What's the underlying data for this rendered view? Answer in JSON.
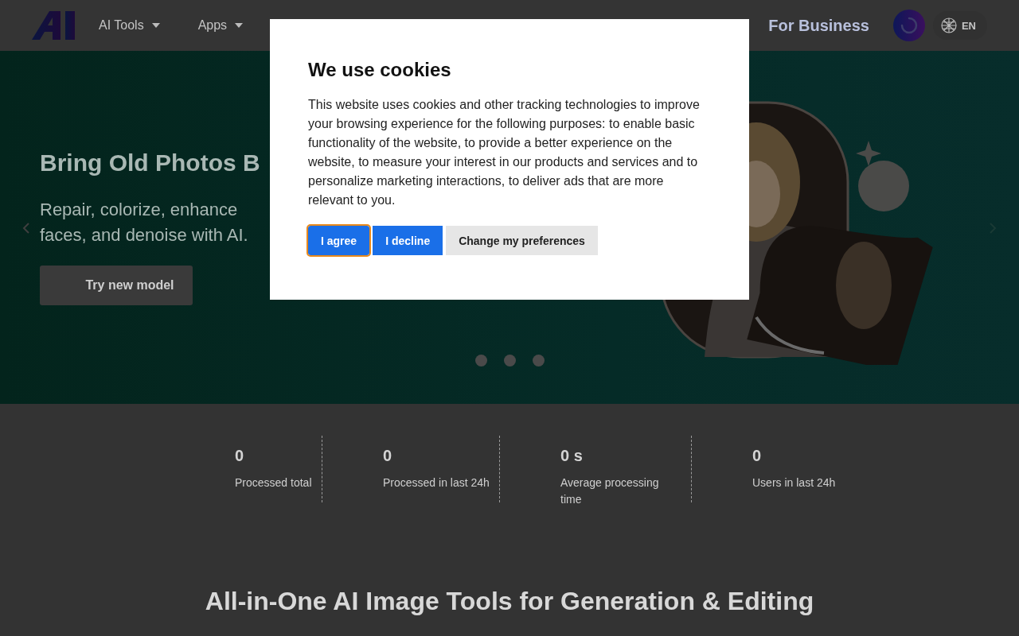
{
  "header": {
    "nav": [
      {
        "label": "AI Tools",
        "has_menu": true
      },
      {
        "label": "Apps",
        "has_menu": true
      }
    ],
    "business_link": "For Business",
    "language": "EN"
  },
  "hero": {
    "title": "Bring Old Photos B",
    "subtitle": "Repair, colorize, enhance faces, and denoise with AI.",
    "button": "Try new model",
    "carousel_dots": [
      {
        "selected": false
      },
      {
        "selected": false
      },
      {
        "selected": false
      }
    ]
  },
  "stats": [
    {
      "value": "0",
      "label": "Processed total"
    },
    {
      "value": "0",
      "label": "Processed in last 24h"
    },
    {
      "value": "0 s",
      "label": "Average processing time"
    },
    {
      "value": "0",
      "label": "Users in last 24h"
    }
  ],
  "section_heading": "All-in-One AI Image Tools for Generation & Editing",
  "cookie_dialog": {
    "title": "We use cookies",
    "text": "This website uses cookies and other tracking technologies to improve your browsing experience for the following purposes: to enable basic functionality of the website, to provide a better experience on the website, to measure your interest in our products and services and to personalize marketing interactions, to deliver ads that are more relevant to you.",
    "buttons": [
      {
        "label": "I agree",
        "kind": "primary",
        "focused": true
      },
      {
        "label": "I decline",
        "kind": "primary",
        "focused": false
      },
      {
        "label": "Change my preferences",
        "kind": "secondary",
        "focused": false
      }
    ]
  }
}
